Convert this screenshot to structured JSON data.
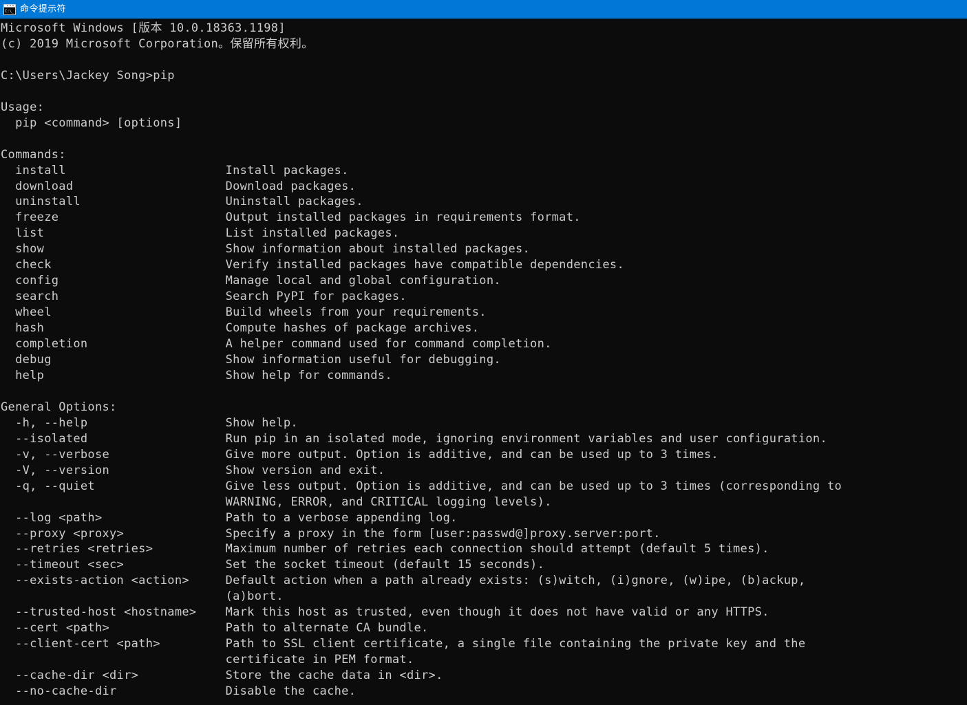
{
  "window": {
    "title": "命令提示符",
    "icon": "command-prompt-icon",
    "icon_glyph": "C:\\_",
    "titlebar_color": "#0078d7",
    "background_color": "#0c0c0c",
    "foreground_color": "#cccccc"
  },
  "console": {
    "banner": [
      "Microsoft Windows [版本 10.0.18363.1198]",
      "(c) 2019 Microsoft Corporation。保留所有权利。"
    ],
    "prompt": {
      "path": "C:\\Users\\Jackey Song",
      "symbol": ">",
      "command": "pip"
    },
    "usage": {
      "heading": "Usage:",
      "line": "  pip <command> [options]"
    },
    "commands": {
      "heading": "Commands:",
      "items": [
        {
          "name": "install",
          "description": "Install packages."
        },
        {
          "name": "download",
          "description": "Download packages."
        },
        {
          "name": "uninstall",
          "description": "Uninstall packages."
        },
        {
          "name": "freeze",
          "description": "Output installed packages in requirements format."
        },
        {
          "name": "list",
          "description": "List installed packages."
        },
        {
          "name": "show",
          "description": "Show information about installed packages."
        },
        {
          "name": "check",
          "description": "Verify installed packages have compatible dependencies."
        },
        {
          "name": "config",
          "description": "Manage local and global configuration."
        },
        {
          "name": "search",
          "description": "Search PyPI for packages."
        },
        {
          "name": "wheel",
          "description": "Build wheels from your requirements."
        },
        {
          "name": "hash",
          "description": "Compute hashes of package archives."
        },
        {
          "name": "completion",
          "description": "A helper command used for command completion."
        },
        {
          "name": "debug",
          "description": "Show information useful for debugging."
        },
        {
          "name": "help",
          "description": "Show help for commands."
        }
      ]
    },
    "general_options": {
      "heading": "General Options:",
      "items": [
        {
          "name": "-h, --help",
          "description": [
            "Show help."
          ]
        },
        {
          "name": "--isolated",
          "description": [
            "Run pip in an isolated mode, ignoring environment variables and user configuration."
          ]
        },
        {
          "name": "-v, --verbose",
          "description": [
            "Give more output. Option is additive, and can be used up to 3 times."
          ]
        },
        {
          "name": "-V, --version",
          "description": [
            "Show version and exit."
          ]
        },
        {
          "name": "-q, --quiet",
          "description": [
            "Give less output. Option is additive, and can be used up to 3 times (corresponding to",
            "WARNING, ERROR, and CRITICAL logging levels)."
          ]
        },
        {
          "name": "--log <path>",
          "description": [
            "Path to a verbose appending log."
          ]
        },
        {
          "name": "--proxy <proxy>",
          "description": [
            "Specify a proxy in the form [user:passwd@]proxy.server:port."
          ]
        },
        {
          "name": "--retries <retries>",
          "description": [
            "Maximum number of retries each connection should attempt (default 5 times)."
          ]
        },
        {
          "name": "--timeout <sec>",
          "description": [
            "Set the socket timeout (default 15 seconds)."
          ]
        },
        {
          "name": "--exists-action <action>",
          "description": [
            "Default action when a path already exists: (s)witch, (i)gnore, (w)ipe, (b)ackup,",
            "(a)bort."
          ]
        },
        {
          "name": "--trusted-host <hostname>",
          "description": [
            "Mark this host as trusted, even though it does not have valid or any HTTPS."
          ]
        },
        {
          "name": "--cert <path>",
          "description": [
            "Path to alternate CA bundle."
          ]
        },
        {
          "name": "--client-cert <path>",
          "description": [
            "Path to SSL client certificate, a single file containing the private key and the",
            "certificate in PEM format."
          ]
        },
        {
          "name": "--cache-dir <dir>",
          "description": [
            "Store the cache data in <dir>."
          ]
        },
        {
          "name": "--no-cache-dir",
          "description": [
            "Disable the cache."
          ]
        }
      ]
    }
  }
}
